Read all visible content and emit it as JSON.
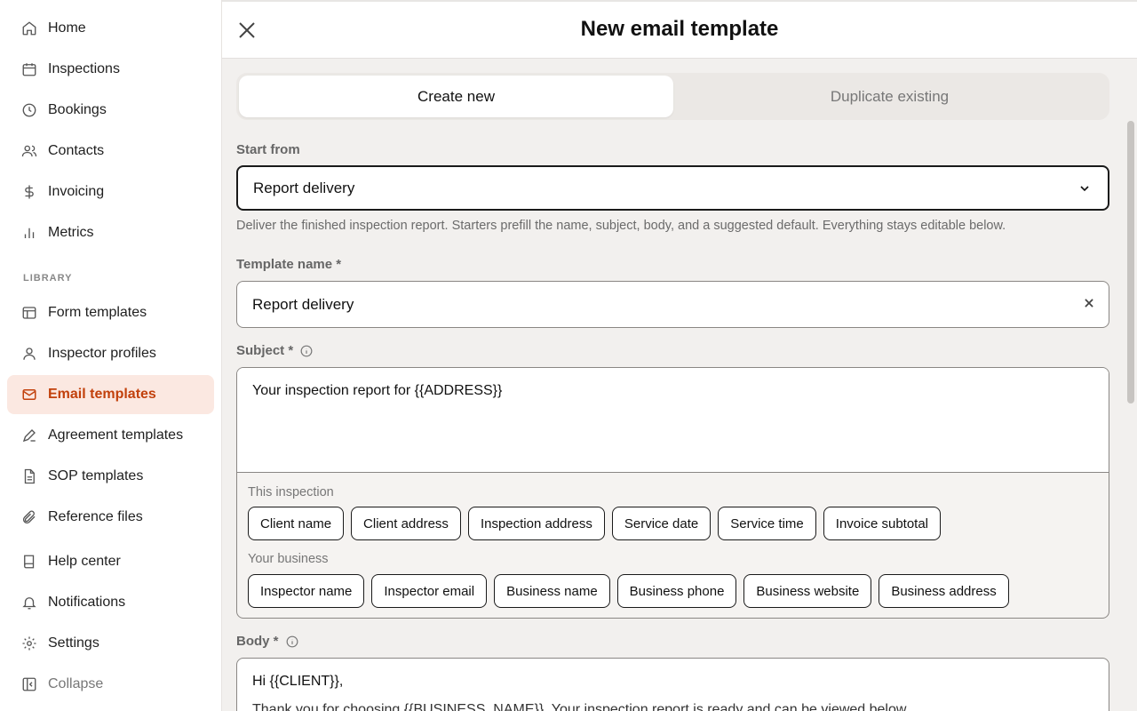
{
  "sidebar": {
    "items": [
      {
        "label": "Home",
        "icon": "home-icon"
      },
      {
        "label": "Inspections",
        "icon": "calendar-icon"
      },
      {
        "label": "Bookings",
        "icon": "clock-icon"
      },
      {
        "label": "Contacts",
        "icon": "users-icon"
      },
      {
        "label": "Invoicing",
        "icon": "dollar-icon"
      },
      {
        "label": "Metrics",
        "icon": "bar-chart-icon"
      }
    ],
    "section_label": "LIBRARY",
    "library_items": [
      {
        "label": "Form templates",
        "icon": "layout-icon"
      },
      {
        "label": "Inspector profiles",
        "icon": "user-icon"
      },
      {
        "label": "Email templates",
        "icon": "mail-icon",
        "active": true
      },
      {
        "label": "Agreement templates",
        "icon": "signature-icon"
      },
      {
        "label": "SOP templates",
        "icon": "document-icon"
      },
      {
        "label": "Reference files",
        "icon": "paperclip-icon"
      }
    ],
    "bottom_items": [
      {
        "label": "Help center",
        "icon": "book-icon"
      },
      {
        "label": "Notifications",
        "icon": "bell-icon"
      },
      {
        "label": "Settings",
        "icon": "gear-icon"
      },
      {
        "label": "Collapse",
        "icon": "collapse-sidebar-icon"
      }
    ],
    "active_color": "#c2410c",
    "active_bg": "#fbe8e1"
  },
  "header": {
    "title": "New email template"
  },
  "tabs": {
    "create_new": "Create new",
    "duplicate_existing": "Duplicate existing"
  },
  "form": {
    "start_from": {
      "label": "Start from",
      "value": "Report delivery",
      "help": "Deliver the finished inspection report. Starters prefill the name, subject, body, and a suggested default. Everything stays editable below."
    },
    "template_name": {
      "label": "Template name *",
      "value": "Report delivery"
    },
    "subject": {
      "label": "Subject *",
      "value": "Your inspection report for {{ADDRESS}}",
      "group_inspection": "This inspection",
      "inspection_chips": [
        "Client name",
        "Client address",
        "Inspection address",
        "Service date",
        "Service time",
        "Invoice subtotal"
      ],
      "group_business": "Your business",
      "business_chips": [
        "Inspector name",
        "Inspector email",
        "Business name",
        "Business phone",
        "Business website",
        "Business address"
      ]
    },
    "body": {
      "label": "Body *",
      "line1": "Hi {{CLIENT}},",
      "line2": "Thank you for choosing {{BUSINESS_NAME}}. Your inspection report is ready and can be viewed below."
    }
  }
}
